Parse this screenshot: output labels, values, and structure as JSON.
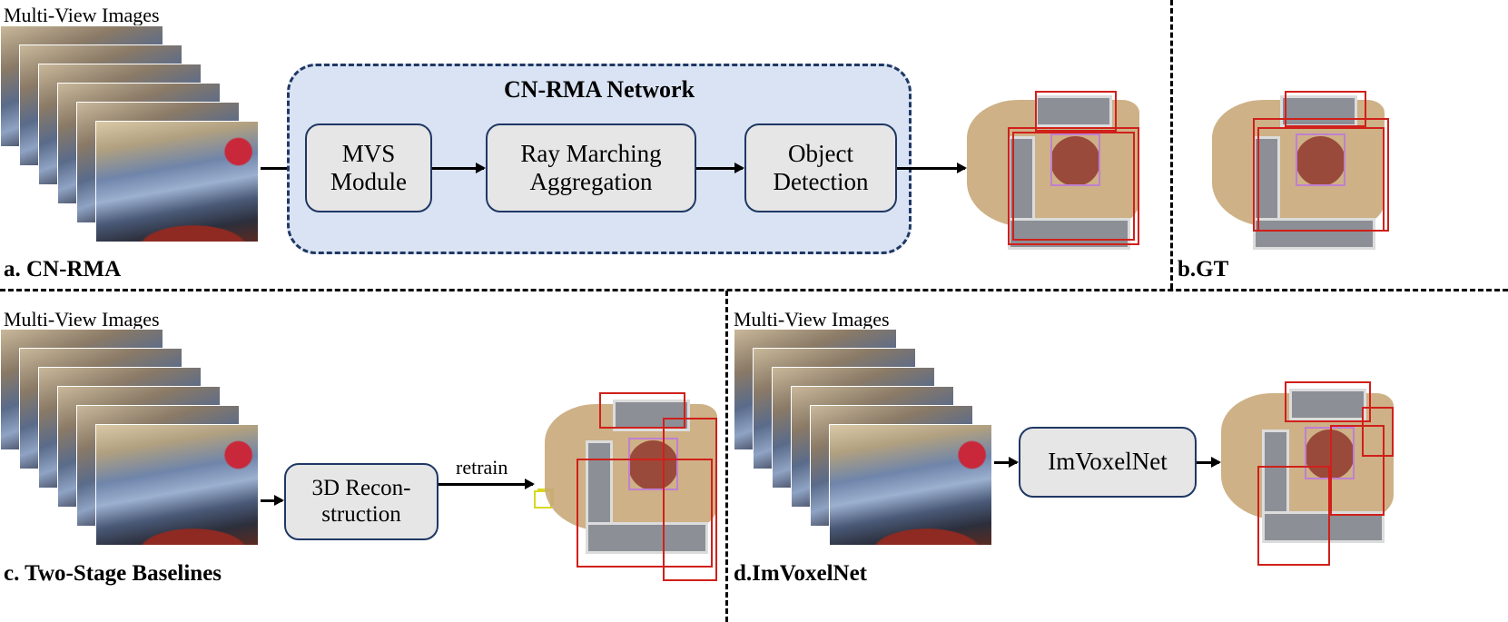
{
  "panel_a": {
    "input_label": "Multi-View Images",
    "title": "a. CN-RMA",
    "network_title": "CN-RMA Network",
    "modules": [
      {
        "label": "MVS\nModule"
      },
      {
        "label": "Ray Marching\nAggregation"
      },
      {
        "label": "Object\nDetection"
      }
    ]
  },
  "panel_b": {
    "title": "b.GT"
  },
  "panel_c": {
    "input_label": "Multi-View Images",
    "title": "c. Two-Stage Baselines",
    "module": "3D Recon-\nstruction",
    "edge_label": "retrain"
  },
  "panel_d": {
    "input_label": "Multi-View Images",
    "title": "d.ImVoxelNet",
    "module": "ImVoxelNet"
  },
  "colors": {
    "network_fill": "#dae3f3",
    "network_border": "#1f3864",
    "module_fill": "#e6e6e6",
    "bbox": "#d0201a",
    "small_bbox": "#d8d820"
  }
}
